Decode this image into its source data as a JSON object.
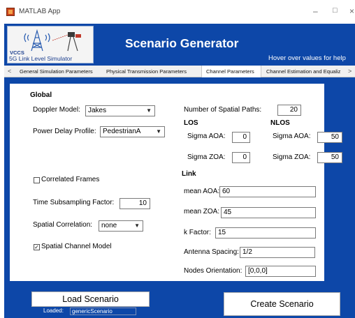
{
  "window": {
    "title": "MATLAB App",
    "controls": {
      "minimize": "–",
      "maximize": "□",
      "close": "×"
    }
  },
  "header": {
    "logo_top_text": "VCCS",
    "logo_text": "5G Link Level Simulator",
    "title": "Scenario Generator",
    "help": "Hover over values for help"
  },
  "tabs": {
    "left_arrow": "<",
    "right_arrow": ">",
    "items": [
      {
        "label": "General Simulation Parameters"
      },
      {
        "label": "Physical Transmission Parameters"
      },
      {
        "label": "Channel Parameters",
        "active": true
      },
      {
        "label": "Channel Estimation and Equaliz"
      }
    ]
  },
  "global": {
    "heading": "Global",
    "doppler_label": "Doppler Model:",
    "doppler_value": "Jakes",
    "pdp_label": "Power Delay Profile:",
    "pdp_value": "PedestrianA",
    "correlated_frames_label": "Correlated Frames",
    "correlated_frames_checked": false,
    "time_subsampling_label": "Time Subsampling Factor:",
    "time_subsampling_value": "10",
    "spatial_correlation_label": "Spatial Correlation:",
    "spatial_correlation_value": "none",
    "spatial_channel_model_label": "Spatial Channel Model",
    "spatial_channel_model_checked": true
  },
  "spatial": {
    "num_paths_label": "Number of Spatial Paths:",
    "num_paths_value": "20",
    "los": {
      "heading": "LOS",
      "sigma_aoa_label": "Sigma AOA:",
      "sigma_aoa_value": "0",
      "sigma_zoa_label": "Sigma ZOA:",
      "sigma_zoa_value": "0"
    },
    "nlos": {
      "heading": "NLOS",
      "sigma_aoa_label": "Sigma AOA:",
      "sigma_aoa_value": "50",
      "sigma_zoa_label": "Sigma ZOA:",
      "sigma_zoa_value": "50"
    }
  },
  "link": {
    "heading": "Link",
    "mean_aoa_label": "mean AOA:",
    "mean_aoa_value": "60",
    "mean_zoa_label": "mean ZOA:",
    "mean_zoa_value": "45",
    "k_factor_label": "k Factor:",
    "k_factor_value": "15",
    "antenna_spacing_label": "Antenna Spacing:",
    "antenna_spacing_value": "1/2",
    "nodes_orientation_label": "Nodes Orientation:",
    "nodes_orientation_value": "[0,0,0]"
  },
  "footer": {
    "load_label": "Load Scenario",
    "loaded_label": "Loaded:",
    "loaded_value": "genericScenario",
    "create_label": "Create Scenario"
  },
  "colors": {
    "frame": "#0d47a8",
    "panel": "#ffffff",
    "tab_bar": "#f0f0f0"
  }
}
